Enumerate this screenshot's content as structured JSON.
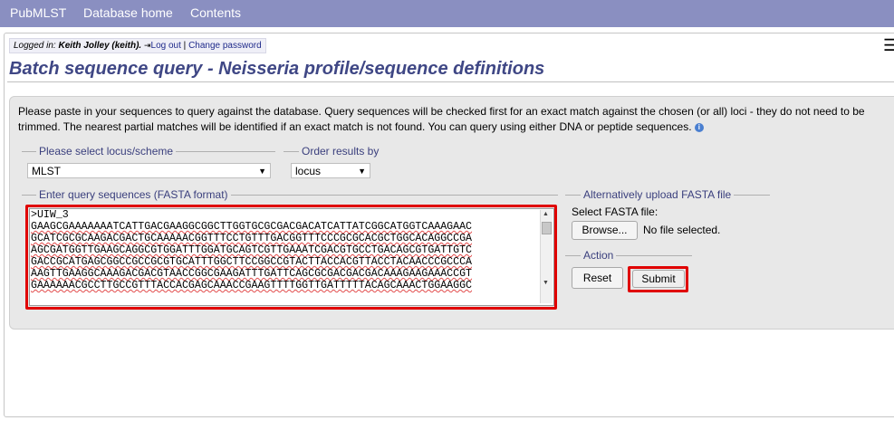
{
  "nav": {
    "brand": "PubMLST",
    "database_home": "Database home",
    "contents": "Contents"
  },
  "login": {
    "prefix": "Logged in:",
    "user": "Keith Jolley (keith).",
    "logout": "Log out",
    "separator": "|",
    "change_password": "Change password"
  },
  "menu_icon": "☰",
  "page_title": "Batch sequence query - Neisseria profile/sequence definitions",
  "intro_text": "Please paste in your sequences to query against the database. Query sequences will be checked first for an exact match against the chosen (or all) loci - they do not need to be trimmed. The nearest partial matches will be identified if an exact match is not found. You can query using either DNA or peptide sequences.",
  "info_icon": "i",
  "locus_scheme": {
    "legend": "Please select locus/scheme",
    "selected": "MLST"
  },
  "order_results": {
    "legend": "Order results by",
    "selected": "locus"
  },
  "query": {
    "legend": "Enter query sequences (FASTA format)",
    "lines": [
      ">UIW_3",
      "GAAGCGAAAAAAATCATTGACGAAGGCGGCTTGGTGCGCGACGACATCATTATCGGCATGGTCAAAGAAC",
      "GCATCGCGCAAGACGACTGCAAAAACGGTTTCCTGTTTGACGGTTTCCCGCGCACGCTGGCACAGGCCGA",
      "AGCGATGGTTGAAGCAGGCGTGGATTTGGATGCAGTCGTTGAAATCGACGTGCCTGACAGCGTGATTGTC",
      "GACCGCATGAGCGGCCGCCGCGTGCATTTGGCTTCCGGCCGTACTTACCACGTTACCTACAACCCGCCCA",
      "AAGTTGAAGGCAAAGACGACGTAACCGGCGAAGATTTGATTCAGCGCGACGACGACAAAGAAGAAACCGT",
      "GAAAAAACGCCTTGCCGTTTACCACGAGCAAACCGAAGTTTTGGTTGATTTTTACAGCAAACTGGAAGGC"
    ]
  },
  "upload": {
    "legend": "Alternatively upload FASTA file",
    "label": "Select FASTA file:",
    "browse": "Browse...",
    "status": "No file selected."
  },
  "action": {
    "legend": "Action",
    "reset": "Reset",
    "submit": "Submit"
  },
  "colors": {
    "nav_bg": "#8a8fc1",
    "title": "#3f4785",
    "legend": "#3a3f7d",
    "highlight": "#e00000",
    "panel_bg": "#e8e8e8"
  }
}
